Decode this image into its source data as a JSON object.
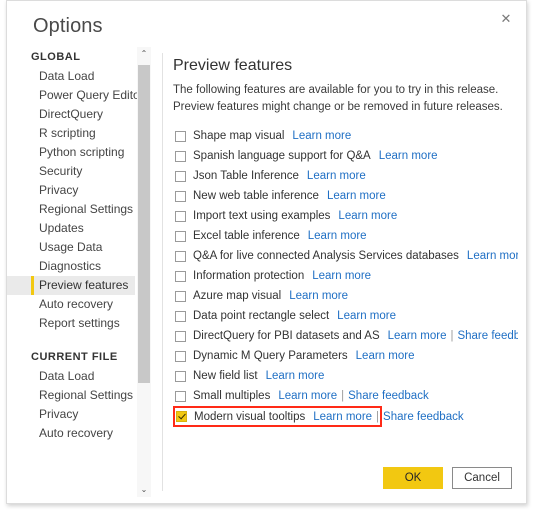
{
  "dialog": {
    "title": "Options",
    "close_label": "✕"
  },
  "sidebar": {
    "groups": [
      {
        "title": "GLOBAL",
        "items": [
          {
            "label": "Data Load",
            "selected": false
          },
          {
            "label": "Power Query Editor",
            "selected": false
          },
          {
            "label": "DirectQuery",
            "selected": false
          },
          {
            "label": "R scripting",
            "selected": false
          },
          {
            "label": "Python scripting",
            "selected": false
          },
          {
            "label": "Security",
            "selected": false
          },
          {
            "label": "Privacy",
            "selected": false
          },
          {
            "label": "Regional Settings",
            "selected": false
          },
          {
            "label": "Updates",
            "selected": false
          },
          {
            "label": "Usage Data",
            "selected": false
          },
          {
            "label": "Diagnostics",
            "selected": false
          },
          {
            "label": "Preview features",
            "selected": true
          },
          {
            "label": "Auto recovery",
            "selected": false
          },
          {
            "label": "Report settings",
            "selected": false
          }
        ]
      },
      {
        "title": "CURRENT FILE",
        "items": [
          {
            "label": "Data Load",
            "selected": false
          },
          {
            "label": "Regional Settings",
            "selected": false
          },
          {
            "label": "Privacy",
            "selected": false
          },
          {
            "label": "Auto recovery",
            "selected": false
          }
        ]
      }
    ],
    "scroll": {
      "up_arrow": "⌃",
      "down_arrow": "⌄"
    }
  },
  "content": {
    "heading": "Preview features",
    "description": "The following features are available for you to try in this release. Preview features might change or be removed in future releases.",
    "link_learn_more": "Learn more",
    "link_share_feedback": "Share feedback",
    "link_separator": "|",
    "features": [
      {
        "label": "Shape map visual",
        "checked": false,
        "learn_more": true,
        "share_feedback": false,
        "highlighted": false
      },
      {
        "label": "Spanish language support for Q&A",
        "checked": false,
        "learn_more": true,
        "share_feedback": false,
        "highlighted": false
      },
      {
        "label": "Json Table Inference",
        "checked": false,
        "learn_more": true,
        "share_feedback": false,
        "highlighted": false
      },
      {
        "label": "New web table inference",
        "checked": false,
        "learn_more": true,
        "share_feedback": false,
        "highlighted": false
      },
      {
        "label": "Import text using examples",
        "checked": false,
        "learn_more": true,
        "share_feedback": false,
        "highlighted": false
      },
      {
        "label": "Excel table inference",
        "checked": false,
        "learn_more": true,
        "share_feedback": false,
        "highlighted": false
      },
      {
        "label": "Q&A for live connected Analysis Services databases",
        "checked": false,
        "learn_more": true,
        "share_feedback": false,
        "highlighted": false
      },
      {
        "label": "Information protection",
        "checked": false,
        "learn_more": true,
        "share_feedback": false,
        "highlighted": false
      },
      {
        "label": "Azure map visual",
        "checked": false,
        "learn_more": true,
        "share_feedback": false,
        "highlighted": false
      },
      {
        "label": "Data point rectangle select",
        "checked": false,
        "learn_more": true,
        "share_feedback": false,
        "highlighted": false
      },
      {
        "label": "DirectQuery for PBI datasets and AS",
        "checked": false,
        "learn_more": true,
        "share_feedback": true,
        "highlighted": false
      },
      {
        "label": "Dynamic M Query Parameters",
        "checked": false,
        "learn_more": true,
        "share_feedback": false,
        "highlighted": false
      },
      {
        "label": "New field list",
        "checked": false,
        "learn_more": true,
        "share_feedback": false,
        "highlighted": false
      },
      {
        "label": "Small multiples",
        "checked": false,
        "learn_more": true,
        "share_feedback": true,
        "highlighted": false
      },
      {
        "label": "Modern visual tooltips",
        "checked": true,
        "learn_more": true,
        "share_feedback": true,
        "highlighted": true
      }
    ]
  },
  "footer": {
    "ok_label": "OK",
    "cancel_label": "Cancel"
  },
  "colors": {
    "accent_gold": "#f2c811",
    "link_blue": "#1f6fc4",
    "highlight_red": "#ff2a17",
    "selected_bg": "#eaeaea"
  }
}
